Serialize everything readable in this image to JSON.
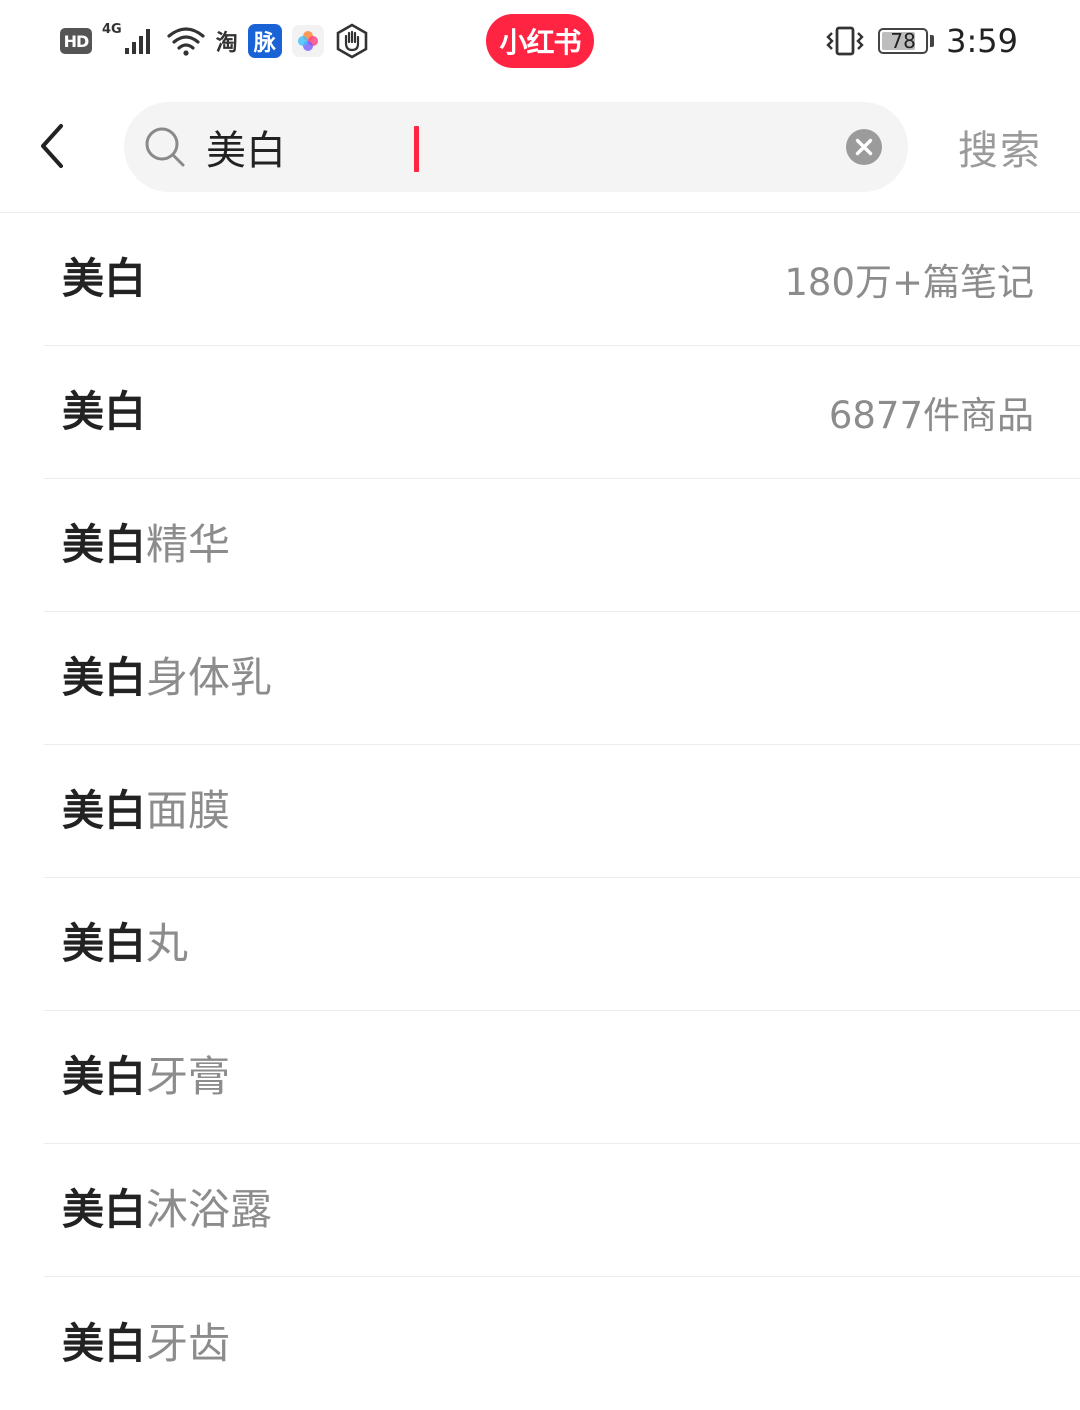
{
  "status_bar": {
    "hd_label": "HD",
    "network_type": "4G",
    "taobao_label": "淘",
    "mai_label": "脉",
    "app_badge": "小红书",
    "battery_level": "78",
    "battery_fraction": 0.78,
    "time": "3:59"
  },
  "search": {
    "query": "美白",
    "submit_label": "搜索"
  },
  "suggestions": [
    {
      "keyword": "美白",
      "rest": "",
      "meta": "180万+篇笔记"
    },
    {
      "keyword": "美白",
      "rest": "",
      "meta": "6877件商品"
    },
    {
      "keyword": "美白",
      "rest": "精华",
      "meta": ""
    },
    {
      "keyword": "美白",
      "rest": "身体乳",
      "meta": ""
    },
    {
      "keyword": "美白",
      "rest": "面膜",
      "meta": ""
    },
    {
      "keyword": "美白",
      "rest": "丸",
      "meta": ""
    },
    {
      "keyword": "美白",
      "rest": "牙膏",
      "meta": ""
    },
    {
      "keyword": "美白",
      "rest": "沐浴露",
      "meta": ""
    },
    {
      "keyword": "美白",
      "rest": "牙齿",
      "meta": ""
    }
  ],
  "colors": {
    "brand_red": "#ff2442",
    "keyword_text": "#222222",
    "muted_text": "#8c8c8c",
    "search_bg": "#f4f4f4"
  },
  "icons": {
    "back": "chevron-left-icon",
    "search": "search-icon",
    "clear": "clear-circle-icon",
    "signal": "signal-icon",
    "wifi": "wifi-icon",
    "vibrate": "vibrate-icon",
    "battery": "battery-icon"
  }
}
